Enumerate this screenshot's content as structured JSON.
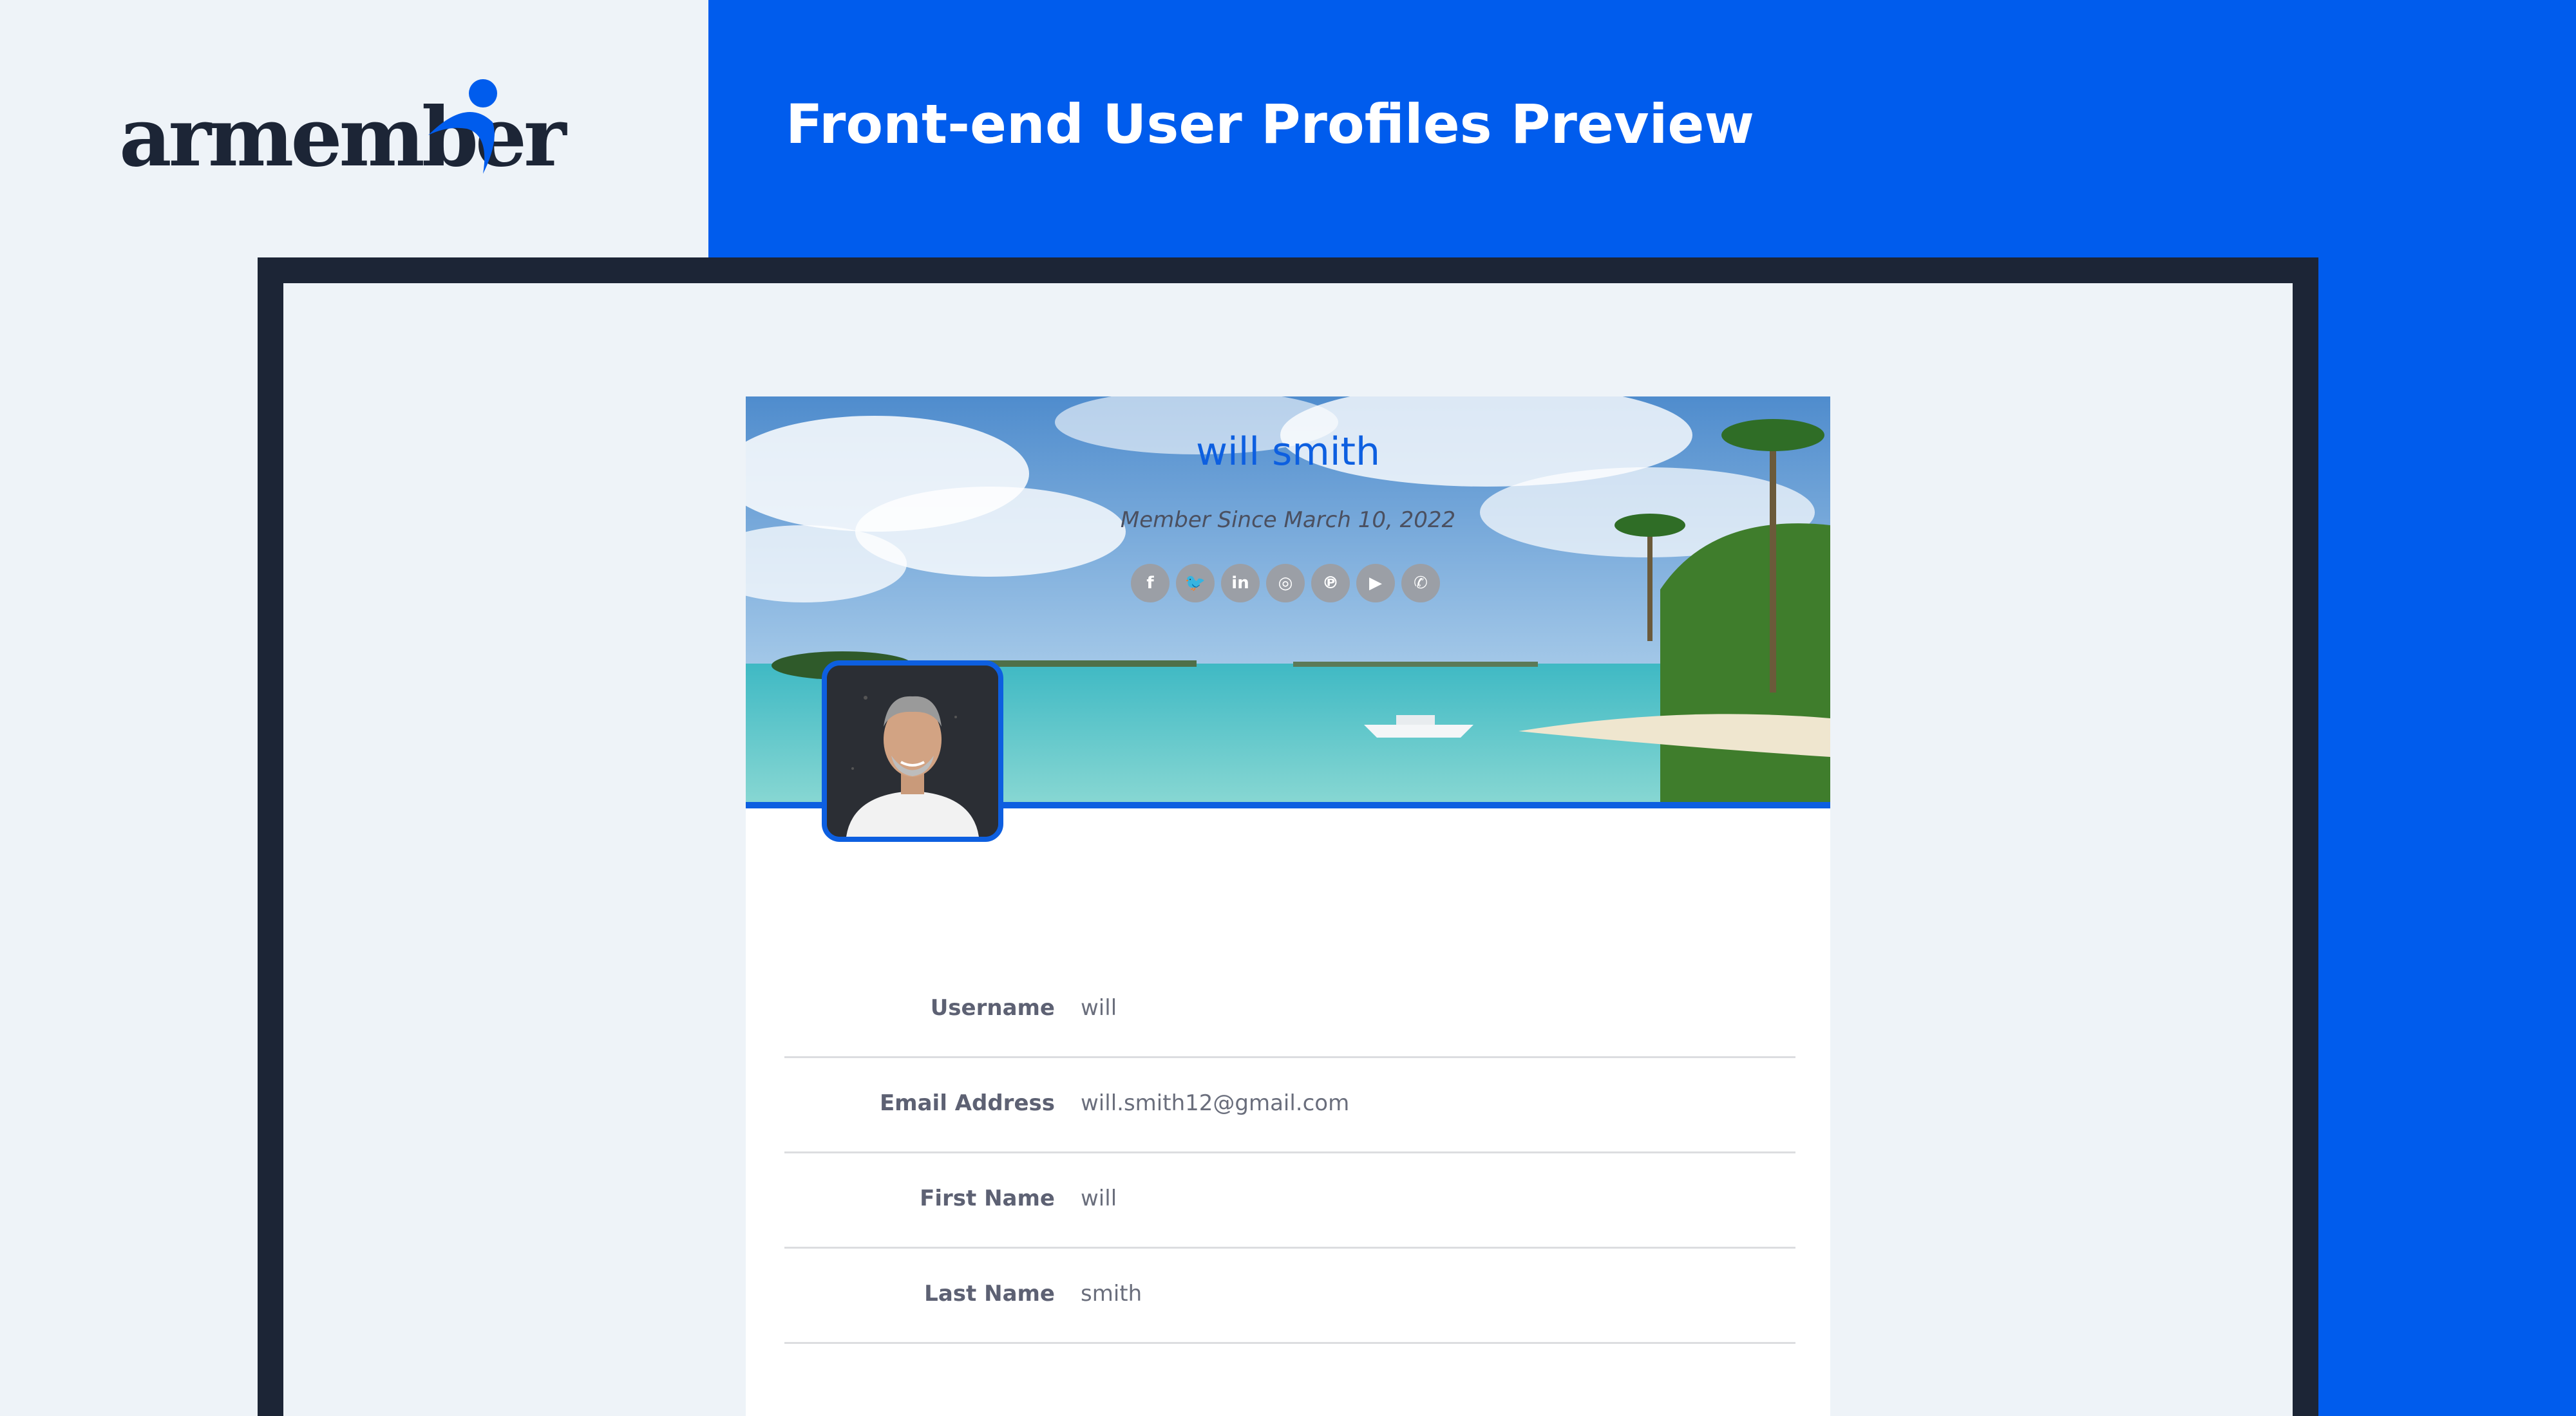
{
  "brand": {
    "logo_text": "armember",
    "accent_color": "#005ced",
    "dark_color": "#1c2536"
  },
  "header": {
    "title": "Front-end User Profiles Preview"
  },
  "profile": {
    "name": "will smith",
    "member_since": "Member Since March 10, 2022",
    "social_icons": [
      {
        "icon": "facebook-icon",
        "glyph": "f"
      },
      {
        "icon": "twitter-icon",
        "glyph": "🐦"
      },
      {
        "icon": "linkedin-icon",
        "glyph": "in"
      },
      {
        "icon": "instagram-icon",
        "glyph": "◎"
      },
      {
        "icon": "pinterest-icon",
        "glyph": "℗"
      },
      {
        "icon": "youtube-icon",
        "glyph": "▶"
      },
      {
        "icon": "whatsapp-icon",
        "glyph": "✆"
      }
    ],
    "fields": [
      {
        "label": "Username",
        "value": "will"
      },
      {
        "label": "Email Address",
        "value": "will.smith12@gmail.com"
      },
      {
        "label": "First Name",
        "value": "will"
      },
      {
        "label": "Last Name",
        "value": "smith"
      }
    ]
  }
}
